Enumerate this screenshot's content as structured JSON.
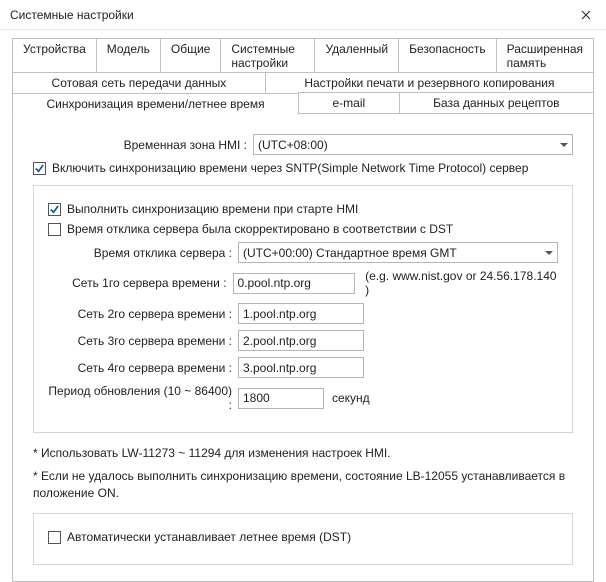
{
  "window": {
    "title": "Системные настройки"
  },
  "tabs": {
    "row1": [
      "Устройства",
      "Модель",
      "Общие",
      "Системные настройки",
      "Удаленный",
      "Безопасность",
      "Расширенная память"
    ],
    "row2": [
      "Сотовая сеть передачи данных",
      "Настройки печати и резервного копирования"
    ],
    "row3": [
      "Синхронизация времени/летнее время",
      "e-mail",
      "База данных рецептов"
    ],
    "active": "Синхронизация времени/летнее время"
  },
  "form": {
    "tz_label": "Временная зона HMI :",
    "tz_value": "(UTC+08:00)",
    "enable_sync": "Включить синхронизацию времени через SNTP(Simple Network Time Protocol) сервер",
    "sync_on_start": "Выполнить синхронизацию времени при старте HMI",
    "dst_corrected": "Время отклика сервера была скорректировано в соответствии с DST",
    "resp_label": "Время отклика сервера :",
    "resp_value": "(UTC+00:00) Стандартное время GMT",
    "ts1_label": "Сеть 1го сервера времени :",
    "ts1_value": "0.pool.ntp.org",
    "ts_hint": "(e.g. www.nist.gov or 24.56.178.140 )",
    "ts2_label": "Сеть 2го сервера времени :",
    "ts2_value": "1.pool.ntp.org",
    "ts3_label": "Сеть 3го сервера времени :",
    "ts3_value": "2.pool.ntp.org",
    "ts4_label": "Сеть 4го сервера времени :",
    "ts4_value": "3.pool.ntp.org",
    "period_label": "Период обновления (10 ~ 86400) :",
    "period_value": "1800",
    "period_unit": "секунд",
    "note1": "* Использовать LW-11273 ~ 11294 для изменения настроек HMI.",
    "note2": "* Если не удалось выполнить синхронизацию времени, состояние LB-12055 устанавливается в положение ON.",
    "auto_dst": "Автоматически устанавливает летнее время (DST)"
  }
}
